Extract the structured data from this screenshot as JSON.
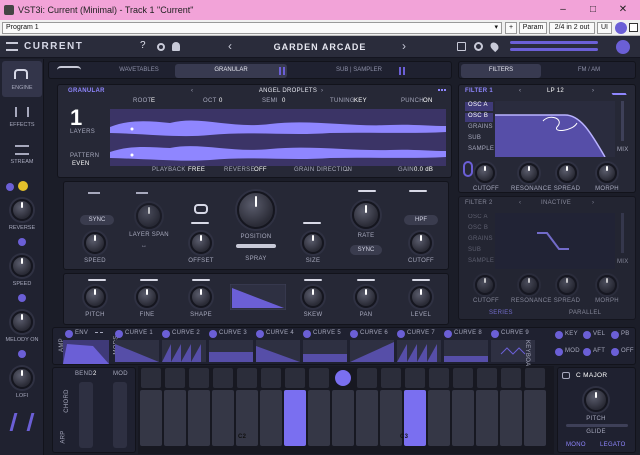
{
  "window": {
    "title": "VST3i: Current (Minimal) - Track 1 \"Current\"",
    "minimize": "–",
    "maximize": "□",
    "close": "✕"
  },
  "host": {
    "program": "Program 1",
    "plus": "+",
    "param": "Param",
    "io": "2/4 in 2 out",
    "ui": "UI"
  },
  "header": {
    "logo": "CURRENT",
    "help": "?",
    "preset_name": "GARDEN ARCADE",
    "prev": "‹",
    "next": "›"
  },
  "sidebar": {
    "engine": "ENGINE",
    "effects": "EFFECTS",
    "stream": "STREAM",
    "knobs": [
      "REVERSE",
      "SPEED",
      "MELODY ON",
      "LOFI"
    ]
  },
  "engine_tabs": {
    "wavetables": "WAVETABLES",
    "granular": "GRANULAR",
    "sub_sampler": "SUB | SAMPLER"
  },
  "filter_tabs": {
    "filters": "FILTERS",
    "fm_am": "FM / AM"
  },
  "granular": {
    "title": "GRANULAR",
    "sample": "ANGEL DROPLETS",
    "root_label": "ROOT",
    "root": "E",
    "oct_label": "OCT",
    "oct": "0",
    "semi_label": "SEMI",
    "semi": "0",
    "tuning_label": "TUNING",
    "tuning": "KEY",
    "punch_label": "PUNCH",
    "punch": "ON",
    "layers_num": "1",
    "layers_label": "LAYERS",
    "pattern_label": "PATTERN",
    "pattern": "EVEN",
    "playback_label": "PLAYBACK",
    "playback": "FREE",
    "reverse_label": "REVERSE",
    "reverse": "OFF",
    "grain_dir_label": "GRAIN DIRECTION",
    "grain_dir": "→",
    "gain_label": "GAIN",
    "gain": "0.0 dB"
  },
  "granular_controls": {
    "sync": "SYNC",
    "layer_span": "LAYER SPAN",
    "speed": "SPEED",
    "offset": "OFFSET",
    "position": "POSITION",
    "spray": "SPRAY",
    "size": "SIZE",
    "rate": "RATE",
    "rate_sync": "SYNC",
    "hpf": "HPF",
    "cutoff": "CUTOFF",
    "pitch": "PITCH",
    "fine": "FINE",
    "shape": "SHAPE",
    "skew": "SKEW",
    "pan": "PAN",
    "level": "LEVEL"
  },
  "filter1": {
    "title": "FILTER 1",
    "type": "LP 12",
    "sources": [
      "OSC A",
      "OSC B",
      "GRAINS",
      "SUB",
      "SAMPLE"
    ],
    "mix": "MIX",
    "cutoff": "CUTOFF",
    "resonance": "RESONANCE",
    "spread": "SPREAD",
    "morph": "MORPH"
  },
  "filter2": {
    "title": "FILTER 2",
    "type": "INACTIVE",
    "sources": [
      "OSC A",
      "OSC B",
      "GRAINS",
      "SUB",
      "SAMPLE"
    ],
    "mix": "MIX",
    "cutoff": "CUTOFF",
    "resonance": "RESONANCE",
    "spread": "SPREAD",
    "morph": "MORPH",
    "series": "SERIES",
    "parallel": "PARALLEL"
  },
  "mod": {
    "amp": "AMP",
    "env": "ENV",
    "mods": "MODS",
    "curves": [
      "CURVE 1",
      "CURVE 2",
      "CURVE 3",
      "CURVE 4",
      "CURVE 5",
      "CURVE 6",
      "CURVE 7",
      "CURVE 8",
      "CURVE 9"
    ],
    "curve_nums": [
      "1",
      "2",
      "3",
      "4",
      "5",
      "6",
      "7",
      "8",
      "9"
    ],
    "keyboard": "KEYBOARD",
    "key": "KEY",
    "vel": "VEL",
    "pb": "PB",
    "mod": "MOD",
    "aft": "AFT",
    "off": "OFF"
  },
  "keyboard": {
    "bend": "BEND",
    "bend_val": "2",
    "mod": "MOD",
    "chord": "CHORD",
    "arp": "ARP",
    "c2": "C2",
    "c3": "C3",
    "scale": "C MAJOR",
    "pitch": "PITCH",
    "glide": "GLIDE",
    "mono": "MONO",
    "legato": "LEGATO"
  },
  "colors": {
    "accent": "#6b5fd6",
    "bg": "#1b1d28",
    "titlebar": "#f2a3d8"
  }
}
